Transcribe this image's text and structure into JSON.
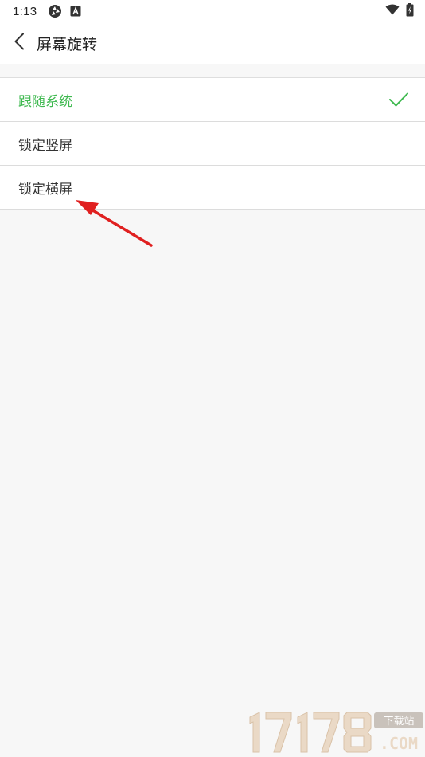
{
  "status_bar": {
    "time": "1:13",
    "left_icons": [
      "system-gear-icon",
      "a-box-icon"
    ],
    "right_icons": [
      "wifi-icon",
      "battery-charging-icon"
    ]
  },
  "header": {
    "back_icon": "chevron-left-icon",
    "title": "屏幕旋转"
  },
  "options": [
    {
      "label": "跟随系统",
      "selected": true
    },
    {
      "label": "锁定竖屏",
      "selected": false
    },
    {
      "label": "锁定横屏",
      "selected": false
    }
  ],
  "colors": {
    "accent": "#3fb950",
    "annotation": "#e02020",
    "background": "#f7f7f7"
  },
  "watermark": {
    "number": "17178",
    "tag": "下载站",
    "suffix": ".COM"
  }
}
